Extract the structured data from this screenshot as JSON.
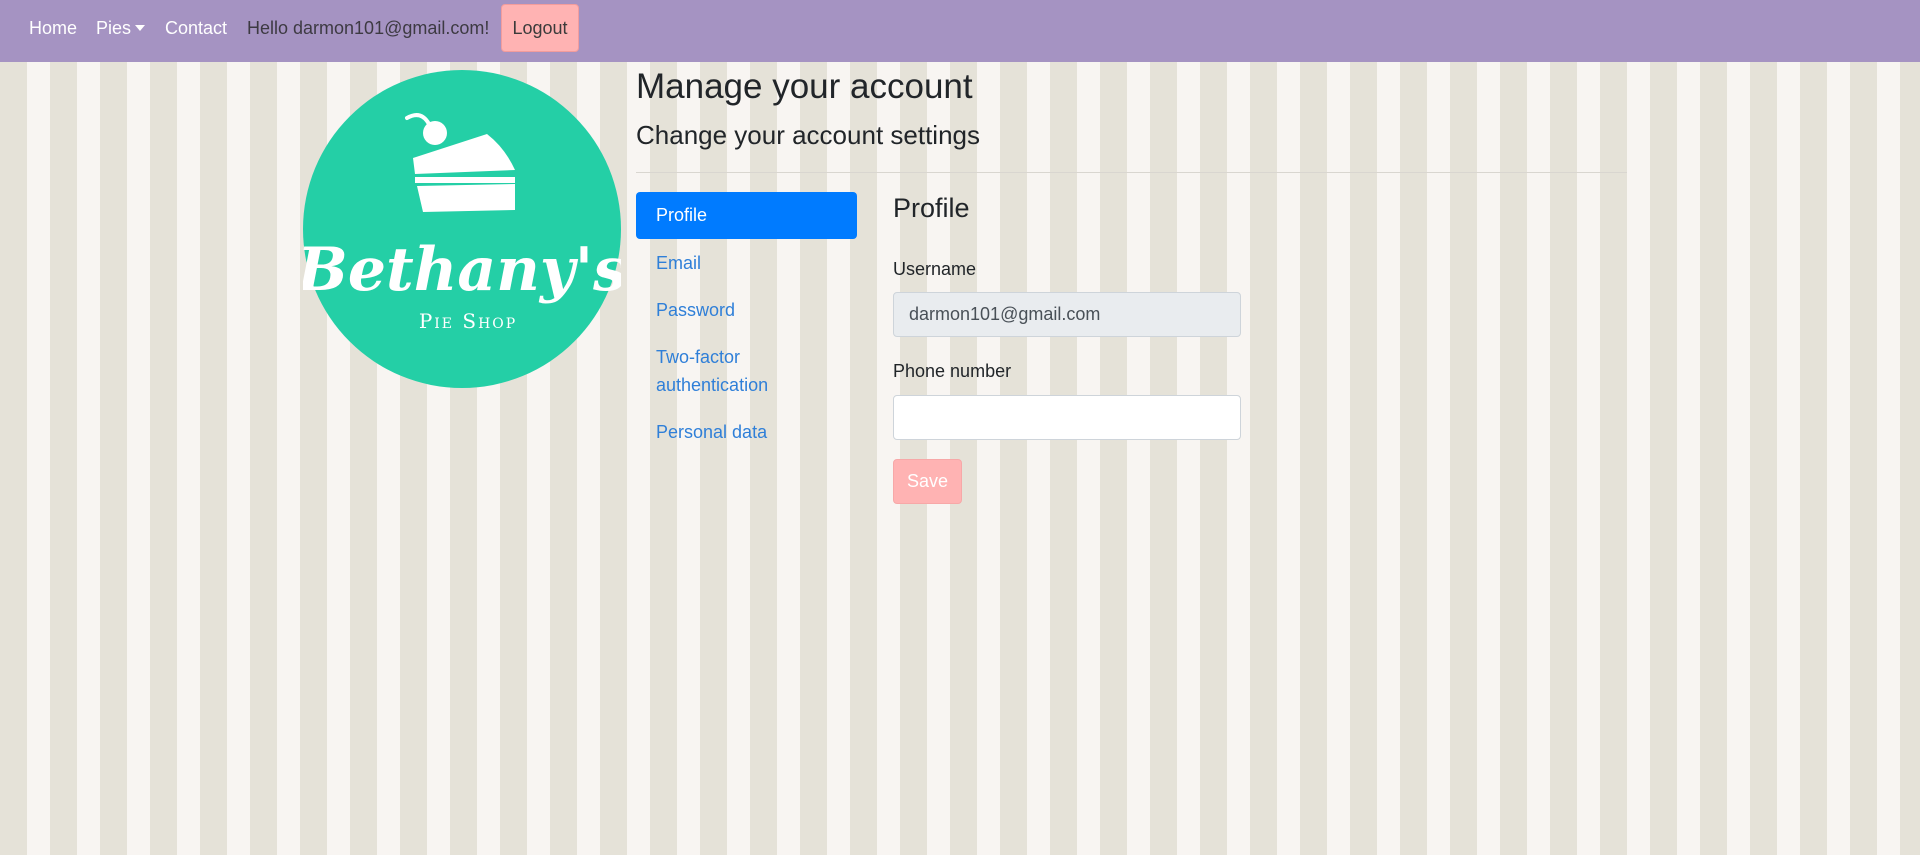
{
  "nav": {
    "home": "Home",
    "pies": "Pies",
    "contact": "Contact",
    "greeting": "Hello darmon101@gmail.com!",
    "logout": "Logout"
  },
  "logo": {
    "name": "Bethany's",
    "tagline": "Pie Shop",
    "color": "#24cfa6"
  },
  "header": {
    "title": "Manage your account",
    "subtitle": "Change your account settings"
  },
  "sidebar": {
    "items": [
      {
        "label": "Profile",
        "active": true
      },
      {
        "label": "Email",
        "active": false
      },
      {
        "label": "Password",
        "active": false
      },
      {
        "label": "Two-factor authentication",
        "active": false
      },
      {
        "label": "Personal data",
        "active": false
      }
    ]
  },
  "profile": {
    "title": "Profile",
    "username_label": "Username",
    "username_value": "darmon101@gmail.com",
    "phone_label": "Phone number",
    "phone_value": "",
    "save_label": "Save"
  },
  "colors": {
    "navbar": "#a593c2",
    "accent": "#007bff",
    "button": "#ffb3b3",
    "link": "#2f7fd8"
  }
}
